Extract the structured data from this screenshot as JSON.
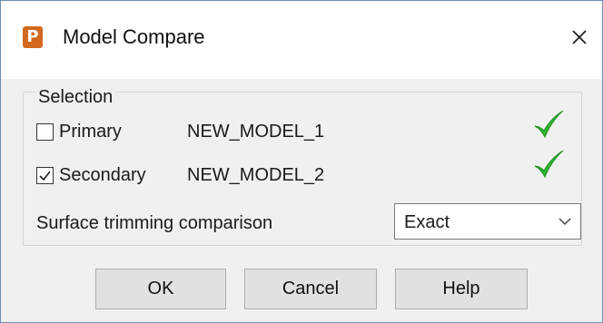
{
  "window": {
    "title": "Model Compare",
    "app_icon_letter": "P",
    "close_icon": "close-icon"
  },
  "selection": {
    "group_label": "Selection",
    "primary": {
      "label": "Primary",
      "checked": false,
      "model": "NEW_MODEL_1",
      "status_icon": "green-check-icon"
    },
    "secondary": {
      "label": "Secondary",
      "checked": true,
      "model": "NEW_MODEL_2",
      "status_icon": "green-check-icon"
    },
    "trimming": {
      "label": "Surface trimming comparison",
      "value": "Exact"
    }
  },
  "buttons": {
    "ok": "OK",
    "cancel": "Cancel",
    "help": "Help"
  },
  "colors": {
    "check_green": "#2fb52f",
    "app_icon": "#d2691e",
    "window_border": "#6e8fb8"
  }
}
